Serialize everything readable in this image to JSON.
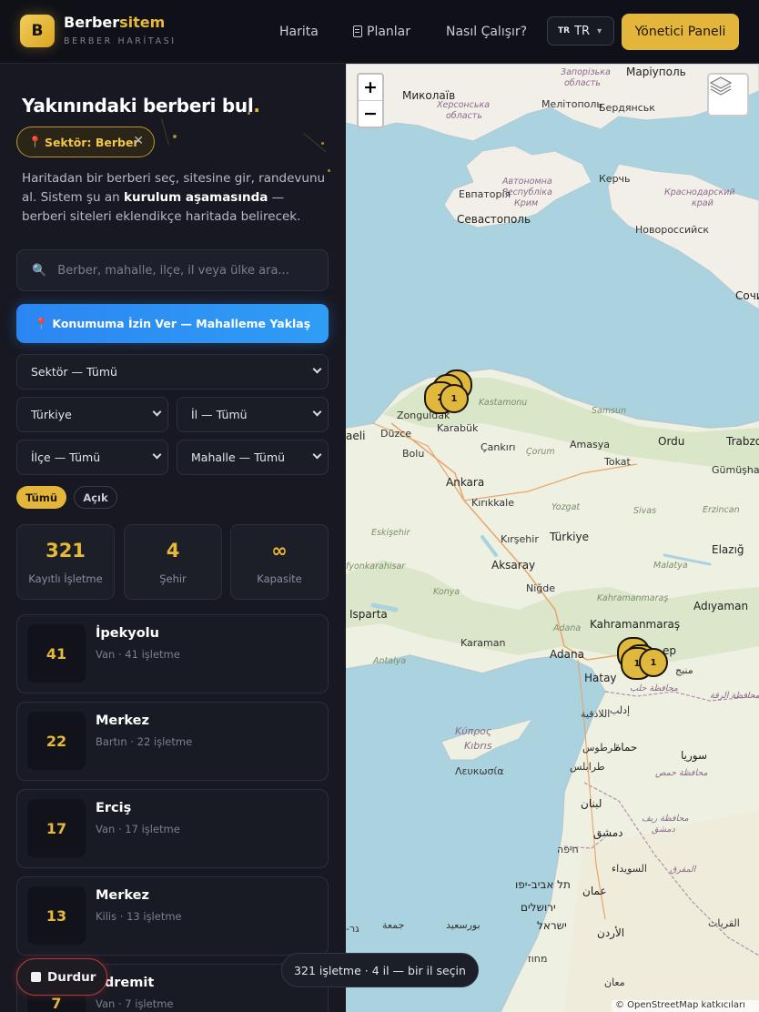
{
  "header": {
    "logo_letter": "B",
    "brand_main": "Berber",
    "brand_accent": "sitem",
    "brand_sub": "BERBER HARİTASI",
    "nav": [
      {
        "label": "Harita"
      },
      {
        "label": "Planlar",
        "icon": "clipboard-icon"
      },
      {
        "label": "Nasıl Çalışır?"
      }
    ],
    "lang": {
      "flag": "TR",
      "label": "TR"
    },
    "admin_label": "Yönetici Paneli"
  },
  "sidebar": {
    "title": "Yakınındaki berberi bul",
    "title_suffix": ".",
    "chip": {
      "label": "Sektör: Berber",
      "icon": "pin-icon"
    },
    "intro": {
      "before": "Haritadan bir berberi seç, sitesine gir, randevunu al. Sistem şu an ",
      "bold": "kurulum aşamasında",
      "after": " — berberi siteleri eklendikçe haritada belirecek."
    },
    "search": {
      "placeholder": "Berber, mahalle, ilçe, il veya ülke ara..."
    },
    "locate_label": "Konumuma İzin Ver — Mahalleme Yaklaş",
    "selects": {
      "sector": "Sektör — Tümü",
      "country": "Türkiye",
      "province": "İl — Tümü",
      "district": "İlçe — Tümü",
      "neighborhood": "Mahalle — Tümü"
    },
    "filters": [
      {
        "label": "Tümü",
        "active": true
      },
      {
        "label": "Açık",
        "active": false
      }
    ],
    "stats": [
      {
        "value": "321",
        "label": "Kayıtlı İşletme"
      },
      {
        "value": "4",
        "label": "Şehir"
      },
      {
        "value": "∞",
        "label": "Kapasite"
      }
    ],
    "places": [
      {
        "count": "41",
        "name": "İpekyolu",
        "meta": "Van · 41 işletme"
      },
      {
        "count": "22",
        "name": "Merkez",
        "meta": "Bartın · 22 işletme"
      },
      {
        "count": "17",
        "name": "Erciş",
        "meta": "Van · 17 işletme"
      },
      {
        "count": "13",
        "name": "Merkez",
        "meta": "Kilis · 13 işletme"
      },
      {
        "count": "7",
        "name": "Edremit",
        "meta": "Van · 7 işletme"
      }
    ],
    "stop_label": "Durdur"
  },
  "map": {
    "zoom_in": "+",
    "zoom_out": "−",
    "clusters": [
      "2",
      "1",
      "1",
      "1"
    ],
    "status": "321 işletme · 4 il — bir il seçin",
    "attribution": "© OpenStreetMap katkıcıları",
    "labels": {
      "zaporizhzhia": "Запорізька",
      "oblast1": "область",
      "mariupol": "Маріуполь",
      "mykolaiv": "Миколаїв",
      "kherson": "Херсонська",
      "oblast2": "область",
      "melitopol": "Мелітополь",
      "berdiansk": "Бердянськ",
      "crimea1": "Автономна",
      "crimea2": "Республіка",
      "crimea3": "Крим",
      "kerch": "Керчь",
      "krasnodar1": "Краснодарский",
      "krasnodar2": "край",
      "yevpatoria": "Евпаторія",
      "sevastopol": "Севастополь",
      "novorossiysk": "Новороссийск",
      "sochi": "Сочи",
      "kastamonu": "Kastamonu",
      "zonguldak": "Zonguldak",
      "karabuk": "Karabük",
      "samsun": "Samsun",
      "sakarya": "aeli",
      "duzce": "Düzce",
      "cankiri": "Çankırı",
      "amasya": "Amasya",
      "ordu": "Ordu",
      "trabzon": "Trabzo",
      "bolu": "Bolu",
      "corum": "Çorum",
      "tokat": "Tokat",
      "gumushane": "Gümüşhane",
      "ankara": "Ankara",
      "kirikkale": "Kırıkkale",
      "yozgat": "Yozgat",
      "sivas": "Sivas",
      "erzincan": "Erzincan",
      "eskisehir": "Eskişehir",
      "kirsehir": "Kırşehir",
      "turkiye": "Türkiye",
      "elazig": "Elazığ",
      "afyon": "fyonkarahisar",
      "aksaray": "Aksaray",
      "malatya": "Malatya",
      "konya": "Konya",
      "nigde": "Niğde",
      "kahramanmaras_reg": "Kahramanmaraş",
      "adiyaman": "Adıyaman",
      "isparta": "Isparta",
      "kahramanmaras": "Kahramanmaraş",
      "karaman": "Karaman",
      "adana_reg": "Adana",
      "gaziantep": "ep",
      "antalya": "Antalya",
      "adana": "Adana",
      "hatay": "Hatay",
      "manbij": "منبج",
      "aleppo": "محافظة حلب",
      "raqqa": "محافظة الرقة",
      "idlib": "إدلب",
      "latakia": "اللاذقية",
      "hama": "حماة",
      "cyprus1": "Κύπρος",
      "cyprus2": "Kıbrıs",
      "lefkosia": "Λευκωσία",
      "tartus": "طرطوس",
      "syria": "سوريا",
      "homs": "محافظة حمص",
      "tripoli": "طرابلس",
      "lebanon": "لبنان",
      "damascus_reg": "محافظة ريف",
      "damascus_reg2": "دمشق",
      "damascus": "دمشق",
      "haifa": "חיפה",
      "sweida": "السويداء",
      "mafraq": "المفرق",
      "telaviv": "תל אביב-יפו",
      "amman": "عمان",
      "jerusalem": "ירושלים",
      "israel": "ישראל",
      "jordan": "الأردن",
      "qurayyat": "القريات",
      "port_said": "بورسعيد",
      "jumah": "جمعة",
      "jur": "-גר",
      "sheva": "מחוז",
      "maan": "معان"
    }
  }
}
